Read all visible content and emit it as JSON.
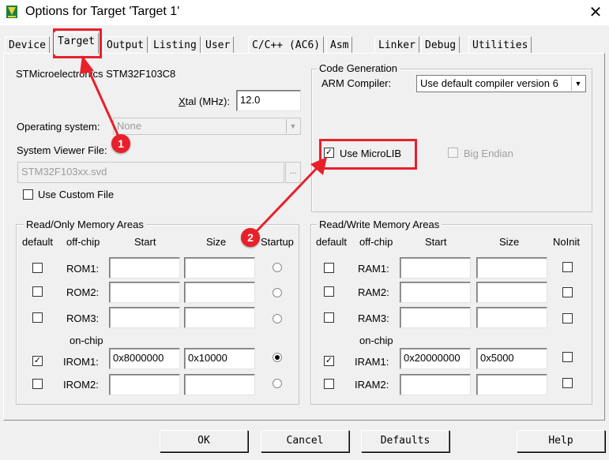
{
  "window": {
    "title": "Options for Target 'Target 1'",
    "close_glyph": "✕"
  },
  "tabs": [
    {
      "label": "Device"
    },
    {
      "label": "Target"
    },
    {
      "label": "Output"
    },
    {
      "label": "Listing"
    },
    {
      "label": "User"
    },
    {
      "label": "C/C++ (AC6)"
    },
    {
      "label": "Asm"
    },
    {
      "label": "Linker"
    },
    {
      "label": "Debug"
    },
    {
      "label": "Utilities"
    }
  ],
  "active_tab": "Target",
  "device_name": "STMicroelectronics STM32F103C8",
  "xtal": {
    "label_prefix": "X",
    "label_rest": "tal (MHz):",
    "value": "12.0"
  },
  "os": {
    "label": "Operating system:",
    "value": "None"
  },
  "system_viewer": {
    "label": "System Viewer File:",
    "value": "STM32F103xx.svd",
    "browse": "..."
  },
  "use_custom_file": {
    "label": "Use Custom File",
    "checked": false
  },
  "code_generation": {
    "title": "Code Generation",
    "compiler_label": "ARM Compiler:",
    "compiler_value": "Use default compiler version 6",
    "use_microlib": {
      "label": "Use MicroLIB",
      "checked": true,
      "check_glyph": "✓"
    },
    "big_endian": {
      "label_prefix": "Bi",
      "label_u": "g",
      "label_rest": " Endian",
      "checked": false
    }
  },
  "ro_memory": {
    "title": "Read/Only Memory Areas",
    "headers": {
      "default": "default",
      "offchip": "off-chip",
      "start": "Start",
      "size": "Size",
      "startup": "Startup"
    },
    "onchip_label": "on-chip",
    "rows": [
      {
        "name": "ROM1:",
        "start": "",
        "size": "",
        "default": false,
        "startup": false
      },
      {
        "name": "ROM2:",
        "start": "",
        "size": "",
        "default": false,
        "startup": false
      },
      {
        "name": "ROM3:",
        "start": "",
        "size": "",
        "default": false,
        "startup": false
      },
      {
        "name": "IROM1:",
        "start": "0x8000000",
        "size": "0x10000",
        "default": true,
        "startup": true
      },
      {
        "name": "IROM2:",
        "start": "",
        "size": "",
        "default": false,
        "startup": false
      }
    ]
  },
  "rw_memory": {
    "title": "Read/Write Memory Areas",
    "headers": {
      "default": "default",
      "offchip": "off-chip",
      "start": "Start",
      "size": "Size",
      "noinit": "NoInit"
    },
    "onchip_label": "on-chip",
    "rows": [
      {
        "name": "RAM1:",
        "start": "",
        "size": "",
        "default": false,
        "noinit": false
      },
      {
        "name": "RAM2:",
        "start": "",
        "size": "",
        "default": false,
        "noinit": false
      },
      {
        "name": "RAM3:",
        "start": "",
        "size": "",
        "default": false,
        "noinit": false
      },
      {
        "name": "IRAM1:",
        "start": "0x20000000",
        "size": "0x5000",
        "default": true,
        "noinit": false
      },
      {
        "name": "IRAM2:",
        "start": "",
        "size": "",
        "default": false,
        "noinit": false
      }
    ]
  },
  "buttons": {
    "ok": "OK",
    "cancel": "Cancel",
    "defaults": "Defaults",
    "help": "Help"
  },
  "annotations": {
    "marker1": "1",
    "marker2": "2",
    "color": "#e8202a"
  },
  "check_glyph": "✓"
}
